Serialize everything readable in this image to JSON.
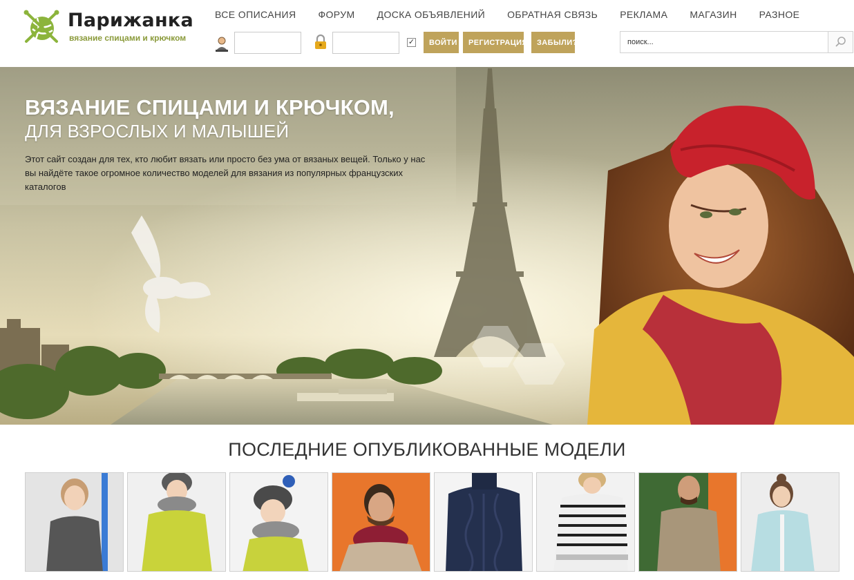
{
  "logo": {
    "title": "Парижанка",
    "subtitle": "вязание спицами и крючком"
  },
  "nav": {
    "items": [
      "ВСЕ ОПИСАНИЯ",
      "ФОРУМ",
      "ДОСКА ОБЪЯВЛЕНИЙ",
      "ОБРАТНАЯ СВЯЗЬ",
      "РЕКЛАМА",
      "МАГАЗИН",
      "РАЗНОЕ"
    ]
  },
  "login": {
    "username_value": "",
    "password_value": "",
    "remember_checked": true,
    "login_label": "ВОЙТИ",
    "register_label": "РЕГИСТРАЦИЯ",
    "forgot_label": "ЗАБЫЛИ?"
  },
  "search": {
    "placeholder": "поиск..."
  },
  "hero": {
    "title_line1": "ВЯЗАНИЕ СПИЦАМИ И КРЮЧКОМ,",
    "title_line2": "ДЛЯ ВЗРОСЛЫХ И МАЛЫШЕЙ",
    "text": "Этот сайт создан для тех, кто любит вязать или просто без ума от вязаных вещей. Только у нас вы найдёте такое огромное количество моделей для вязания из популярных французских каталогов"
  },
  "latest": {
    "title": "ПОСЛЕДНИЕ ОПУБЛИКОВАННЫЕ МОДЕЛИ"
  },
  "icons": {
    "user": "user-icon",
    "lock": "lock-icon",
    "check": "checkbox-icon",
    "search": "search-icon"
  },
  "colors": {
    "button": "#bfa35b",
    "logo_green": "#8cb43c",
    "text_dark": "#333333"
  }
}
